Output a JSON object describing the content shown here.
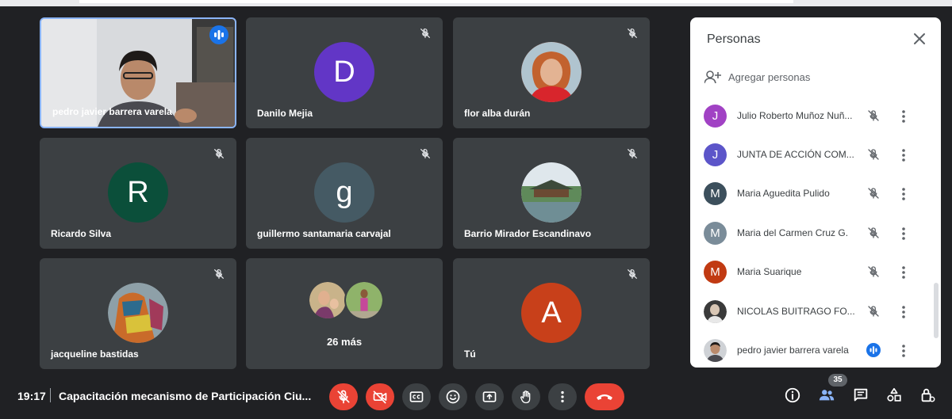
{
  "colors": {
    "background": "#202124",
    "tile": "#3c4043",
    "accent_blue": "#1a73e8",
    "hangup_red": "#ea4335",
    "panel_bg": "#ffffff"
  },
  "tiles": [
    {
      "name": "pedro javier barrera varela",
      "type": "camera",
      "speaking": true
    },
    {
      "name": "Danilo Mejia",
      "initial": "D",
      "avatar_color": "#6236c6",
      "muted": true
    },
    {
      "name": "flor alba durán",
      "type": "photo",
      "muted": true
    },
    {
      "name": "Ricardo Silva",
      "initial": "R",
      "avatar_color": "#0b4f3a",
      "muted": true
    },
    {
      "name": "guillermo santamaria carvajal",
      "initial": "g",
      "avatar_color": "#455a64",
      "muted": true
    },
    {
      "name": "Barrio Mirador Escandinavo",
      "type": "photo",
      "muted": true
    },
    {
      "name": "jacqueline bastidas",
      "type": "photo",
      "muted": true
    },
    {
      "name": "",
      "more_label": "26 más"
    },
    {
      "name": "Tú",
      "initial": "A",
      "avatar_color": "#c8401a",
      "muted": true
    }
  ],
  "panel": {
    "title": "Personas",
    "close_icon": "close-icon",
    "add_people_label": "Agregar personas",
    "participants": [
      {
        "name": "Julio Roberto Muñoz Nuñ...",
        "initial": "J",
        "color": "#a142c4",
        "muted": true
      },
      {
        "name": "JUNTA DE ACCIÓN COM...",
        "initial": "J",
        "color": "#5c55c9",
        "muted": true
      },
      {
        "name": "Maria Aguedita Pulido",
        "initial": "M",
        "color": "#3c4f5c",
        "muted": true
      },
      {
        "name": "Maria del Carmen Cruz G.",
        "initial": "M",
        "color": "#7a8c99",
        "muted": true
      },
      {
        "name": "Maria Suarique",
        "initial": "M",
        "color": "#c13a12",
        "muted": true
      },
      {
        "name": "NICOLAS BUITRAGO FO...",
        "initial": "",
        "color": "#4a4a4a",
        "muted": true
      },
      {
        "name": "pedro javier barrera varela",
        "initial": "",
        "color": "#8a7a6a",
        "muted": false,
        "speaking": true
      }
    ]
  },
  "bottombar": {
    "time": "19:17",
    "meeting_title": "Capacitación mecanismo de Participación Ciu...",
    "people_count": "35"
  }
}
